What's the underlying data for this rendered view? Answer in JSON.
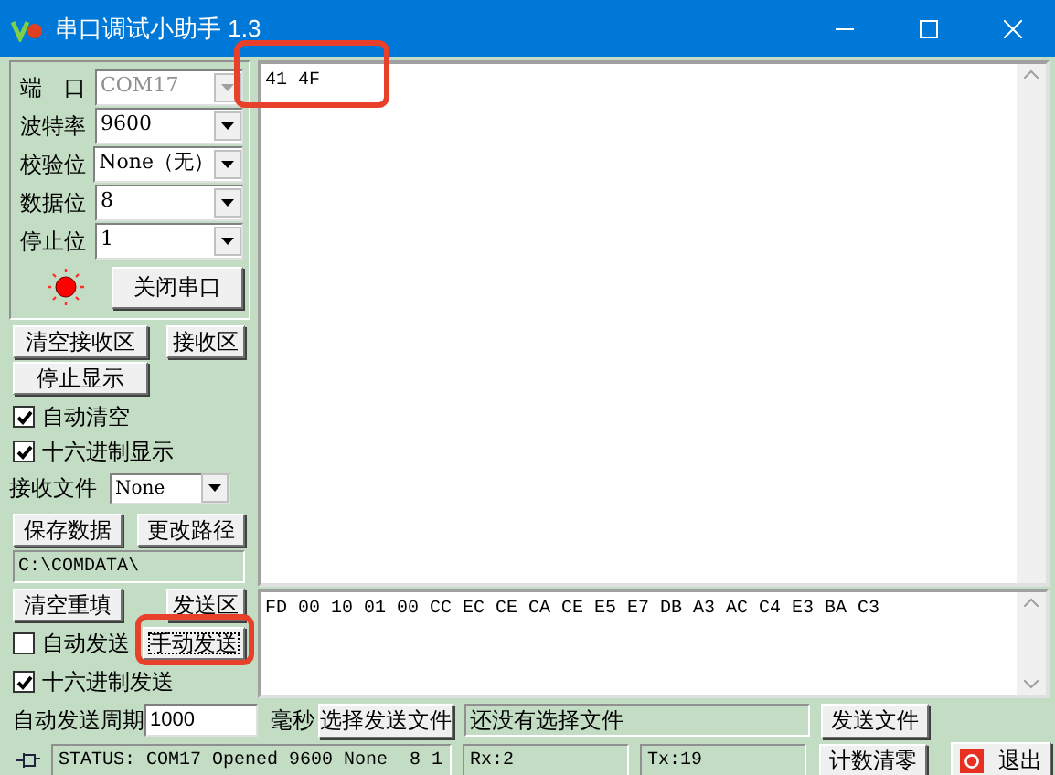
{
  "window": {
    "title": "串口调试小助手 1.3"
  },
  "settings": [
    {
      "label": "端　口",
      "value": "COM17",
      "disabled": true
    },
    {
      "label": "波特率",
      "value": "9600",
      "disabled": false
    },
    {
      "label": "校验位",
      "value": "None（无）",
      "disabled": false
    },
    {
      "label": "数据位",
      "value": "8",
      "disabled": false
    },
    {
      "label": "停止位",
      "value": "1",
      "disabled": false
    }
  ],
  "port_indicator": {
    "on": true
  },
  "open_close_button": "关闭串口",
  "receive_controls": {
    "clear_button": "清空接收区",
    "area_label": "接收区",
    "stop_button": "停止显示",
    "checkboxes": [
      {
        "label": "自动清空",
        "checked": true
      },
      {
        "label": "十六进制显示",
        "checked": true
      }
    ],
    "file_label": "接收文件",
    "file_select": "None",
    "save_button": "保存数据",
    "path_button": "更改路径",
    "path": "C:\\COMDATA\\"
  },
  "receive_area": {
    "text": "41 4F",
    "highlighted": true
  },
  "send_controls": {
    "clear_button": "清空重填",
    "area_label": "发送区",
    "checkboxes": [
      {
        "label": "自动发送",
        "checked": false
      },
      {
        "label": "十六进制发送",
        "checked": true
      }
    ],
    "manual_send_button": {
      "label": "手动发送",
      "highlighted": true
    }
  },
  "send_area": {
    "text": "FD 00 10 01 00 CC EC CE CA CE E5 E7 DB A3 AC C4 E3 BA C3"
  },
  "period": {
    "label": "自动发送周期",
    "value": "1000",
    "unit": "毫秒"
  },
  "choose_file_button": "选择发送文件",
  "file_status": "还没有选择文件",
  "send_file_button": "发送文件",
  "status_bar": {
    "status": "STATUS: COM17 Opened 9600 None  8 1",
    "rx": "Rx:2",
    "tx": "Tx:19"
  },
  "reset_count_button": "计数清零",
  "exit_button": "退出"
}
